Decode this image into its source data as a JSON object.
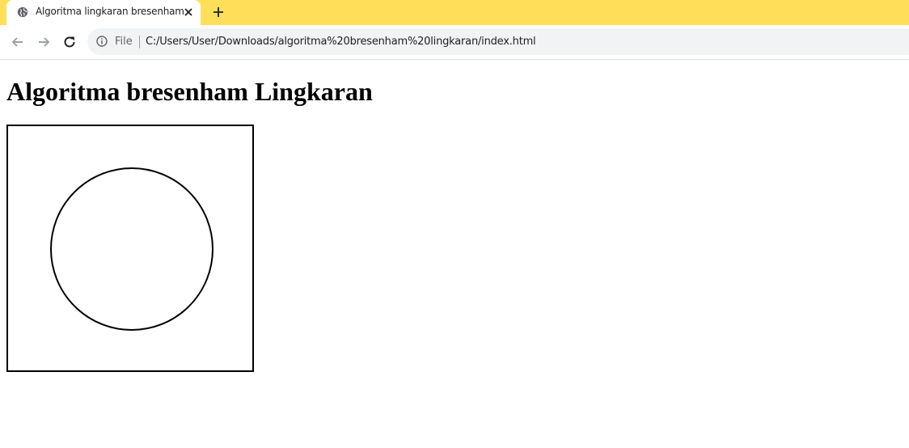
{
  "browser": {
    "tab": {
      "title": "Algoritma lingkaran bresenham"
    },
    "address_bar": {
      "scheme_label": "File",
      "url": "C:/Users/User/Downloads/algoritma%20bresenham%20lingkaran/index.html"
    },
    "icons": {
      "favicon": "globe-icon",
      "close": "close-icon",
      "new_tab": "plus-icon",
      "back": "back-arrow-icon",
      "forward": "forward-arrow-icon",
      "reload": "reload-icon",
      "info": "info-icon"
    },
    "colors": {
      "tabstrip": "#ffdf5a",
      "omnibox": "#f1f3f4"
    }
  },
  "page": {
    "heading": "Algoritma bresenham Lingkaran",
    "canvas": {
      "shape": "circle",
      "stroke_color": "#000000"
    }
  }
}
